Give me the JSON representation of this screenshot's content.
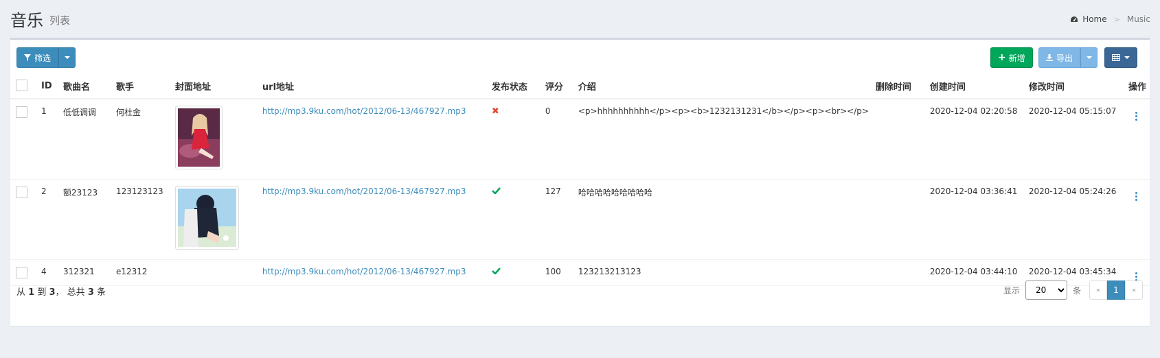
{
  "page": {
    "title": "音乐",
    "subtitle": "列表"
  },
  "breadcrumb": {
    "home": "Home",
    "separator": ">",
    "current": "Music"
  },
  "toolbar": {
    "filter_label": "筛选",
    "add_label": "新增",
    "export_label": "导出"
  },
  "table": {
    "headers": {
      "id": "ID",
      "name": "歌曲名",
      "singer": "歌手",
      "cover": "封面地址",
      "url": "url地址",
      "status": "发布状态",
      "score": "评分",
      "intro": "介绍",
      "deleted": "删除时间",
      "created": "创建时间",
      "updated": "修改时间",
      "actions": "操作"
    },
    "rows": [
      {
        "id": "1",
        "name": "低低调调",
        "singer": "何杜金",
        "has_cover": true,
        "url": "http://mp3.9ku.com/hot/2012/06-13/467927.mp3",
        "published": false,
        "score": "0",
        "intro": "<p>hhhhhhhhhh</p><p><b>1232131231</b></p><p><br></p>",
        "deleted": "",
        "created": "2020-12-04 02:20:58",
        "updated": "2020-12-04 05:15:07"
      },
      {
        "id": "2",
        "name": "额23123",
        "singer": "123123123",
        "has_cover": true,
        "url": "http://mp3.9ku.com/hot/2012/06-13/467927.mp3",
        "published": true,
        "score": "127",
        "intro": "哈哈哈哈哈哈哈哈哈",
        "deleted": "",
        "created": "2020-12-04 03:36:41",
        "updated": "2020-12-04 05:24:26"
      },
      {
        "id": "4",
        "name": "312321",
        "singer": "e12312",
        "has_cover": false,
        "url": "http://mp3.9ku.com/hot/2012/06-13/467927.mp3",
        "published": true,
        "score": "100",
        "intro": "123213213123",
        "deleted": "",
        "created": "2020-12-04 03:44:10",
        "updated": "2020-12-04 03:45:34"
      }
    ]
  },
  "footer": {
    "summary_prefix": "从",
    "from": "1",
    "to_word": "到",
    "to": "3",
    "total_prefix": "， 总共",
    "total": "3",
    "total_suffix": "条",
    "show_label": "显示",
    "per_page": "20",
    "per_page_suffix": "条",
    "prev": "«",
    "current_page": "1",
    "next": "»"
  },
  "colors": {
    "primary": "#3c8dbc",
    "success": "#00a65a",
    "danger": "#dd4b39",
    "export": "#7fb7e6",
    "columns_btn": "#3a6796"
  },
  "icons": {
    "breadcrumb_home": "dashboard-icon",
    "filter": "filter-icon",
    "add": "plus-icon",
    "export": "download-icon",
    "columns": "table-columns-icon",
    "unpublished": "close-icon",
    "published": "check-icon",
    "row_actions": "kebab-menu-icon"
  }
}
